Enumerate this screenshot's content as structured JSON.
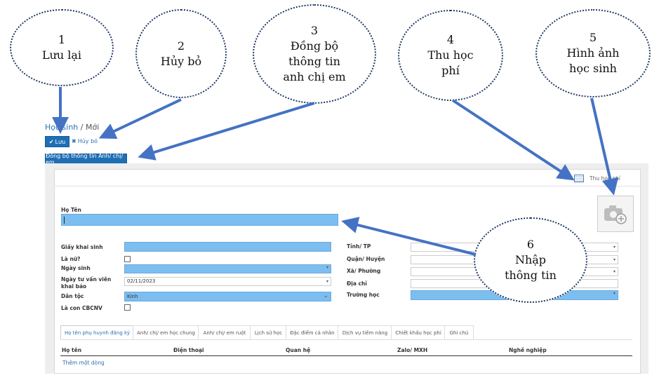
{
  "callouts": [
    {
      "num": "1",
      "text": "Lưu lại"
    },
    {
      "num": "2",
      "text": "Hủy bỏ"
    },
    {
      "num": "3",
      "line1": "Đồng bộ",
      "line2": "thông tin",
      "line3": "anh chị em"
    },
    {
      "num": "4",
      "line1": "Thu học",
      "line2": "phí"
    },
    {
      "num": "5",
      "line1": "Hình ảnh",
      "line2": "học sinh"
    },
    {
      "num": "6",
      "line1": "Nhập",
      "line2": "thông tin"
    }
  ],
  "breadcrumb": {
    "parent": "Học sinh",
    "separator": " / ",
    "current": "Mới"
  },
  "toolbar": {
    "save_label": "Lưu",
    "cancel_label": "Hủy bỏ",
    "sync_label": "Đồng bộ thông tin Anh/ chị/ em"
  },
  "header": {
    "fee_label": "Thu học phí"
  },
  "form": {
    "name_label": "Họ Tên",
    "birth_cert_label": "Giấy khai sinh",
    "is_female_label": "Là nữ?",
    "dob_label": "Ngày sinh",
    "consult_date_label": "Ngày tư vấn viên khai báo",
    "consult_date_value": "02/11/2023",
    "ethnicity_label": "Dân tộc",
    "ethnicity_value": "Kinh",
    "staff_child_label": "Là con CBCNV",
    "province_label": "Tỉnh/ TP",
    "district_label": "Quận/ Huyện",
    "ward_label": "Xã/ Phường",
    "address_label": "Địa chỉ",
    "school_label": "Trường học"
  },
  "tabs": [
    "Họ tên phụ huynh đăng ký",
    "Anh/ chị/ em học chung",
    "Anh/ chị/ em ruột",
    "Lịch sử học",
    "Đặc điểm cá nhân",
    "Dịch vụ tiềm năng",
    "Chiết khấu học phí",
    "Ghi chú"
  ],
  "table": {
    "columns": [
      "Họ tên",
      "Điện thoại",
      "Quan hệ",
      "Zalo/ MXH",
      "Nghề nghiệp"
    ],
    "add_row": "Thêm một dòng"
  },
  "colors": {
    "primary": "#1f6fb5",
    "field_highlight": "#7cbef0",
    "arrow": "#4472c4"
  }
}
